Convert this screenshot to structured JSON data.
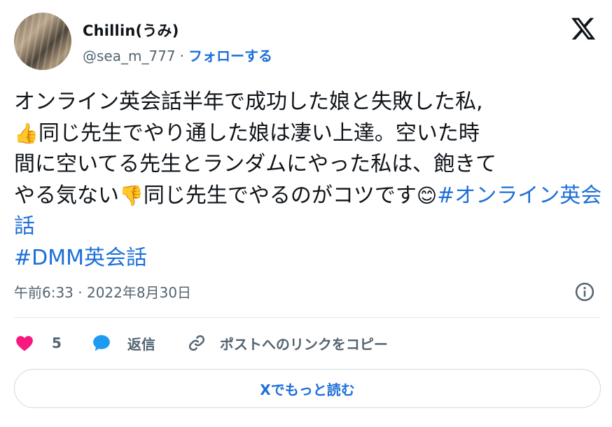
{
  "author": {
    "display_name": "Chillin(うみ)",
    "handle": "@sea_m_777",
    "separator": "·",
    "follow_label": "フォローする"
  },
  "tweet": {
    "line1": "オンライン英会話半年で成功した娘と失敗した私,",
    "emoji_thumbs_up": "👍",
    "line2": "同じ先生でやり通した娘は凄い上達。空いた時",
    "line3": "間に空いてる先生とランダムにやった私は、飽きて",
    "line4a": "やる気ない",
    "emoji_thumbs_down": "👎",
    "line4b": "同じ先生でやるのがコツです",
    "emoji_smile": "😊",
    "hashtag1": "#オンライン英会話",
    "hashtag2": "#DMM英会話"
  },
  "meta": {
    "timestamp": "午前6:33 · 2022年8月30日"
  },
  "actions": {
    "like_count": "5",
    "reply_label": "返信",
    "copy_link_label": "ポストへのリンクをコピー"
  },
  "read_more_label": "Xでもっと読む",
  "colors": {
    "link_blue": "#1d6fd8",
    "heart_pink": "#f91880",
    "reply_blue": "#1d9bf0",
    "muted_gray": "#536471"
  },
  "icons": [
    "x-logo-icon",
    "info-icon",
    "heart-icon",
    "reply-bubble-icon",
    "link-icon"
  ]
}
